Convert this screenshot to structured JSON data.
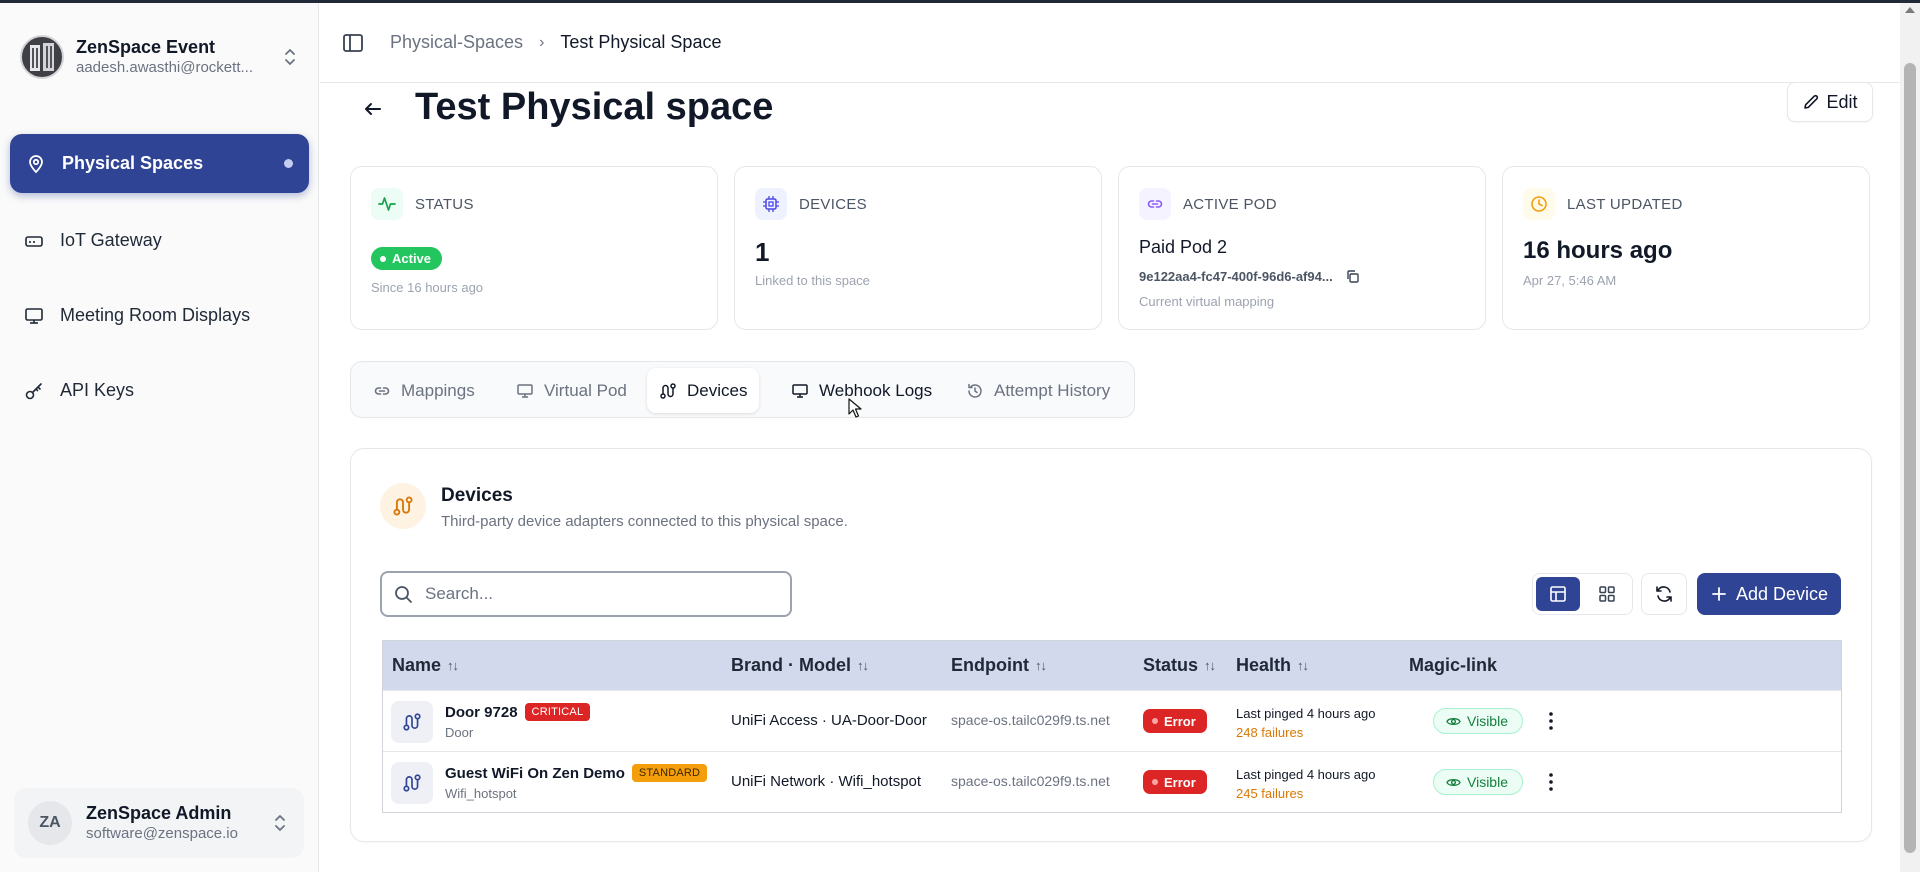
{
  "workspace": {
    "title": "ZenSpace Event",
    "subtitle": "aadesh.awasthi@rockett..."
  },
  "sidebar": {
    "items": [
      {
        "label": "Physical Spaces",
        "icon": "map-pin-icon",
        "active": true
      },
      {
        "label": "IoT Gateway",
        "icon": "router-icon",
        "active": false
      },
      {
        "label": "Meeting Room Displays",
        "icon": "monitor-icon",
        "active": false
      },
      {
        "label": "API Keys",
        "icon": "key-icon",
        "active": false
      }
    ]
  },
  "user": {
    "initials": "ZA",
    "name": "ZenSpace Admin",
    "email": "software@zenspace.io"
  },
  "breadcrumb": {
    "parent": "Physical-Spaces",
    "current": "Test Physical Space"
  },
  "page": {
    "title": "Test Physical space",
    "edit_label": "Edit"
  },
  "cards": {
    "status": {
      "label": "STATUS",
      "badge": "Active",
      "sub": "Since 16 hours ago"
    },
    "devices": {
      "label": "DEVICES",
      "value": "1",
      "sub": "Linked to this space"
    },
    "pod": {
      "label": "ACTIVE POD",
      "name": "Paid Pod 2",
      "id": "9e122aa4-fc47-400f-96d6-af94...",
      "sub": "Current virtual mapping"
    },
    "updated": {
      "label": "LAST UPDATED",
      "value": "16 hours ago",
      "sub": "Apr 27, 5:46 AM"
    }
  },
  "tabs": [
    {
      "label": "Mappings",
      "icon": "link-icon"
    },
    {
      "label": "Virtual Pod",
      "icon": "monitor-icon"
    },
    {
      "label": "Devices",
      "icon": "route-icon",
      "active": true
    },
    {
      "label": "Webhook Logs",
      "icon": "monitor-icon"
    },
    {
      "label": "Attempt History",
      "icon": "history-icon"
    }
  ],
  "devices_panel": {
    "title": "Devices",
    "subtitle": "Third-party device adapters connected to this physical space.",
    "search_placeholder": "Search...",
    "add_label": "Add Device",
    "columns": [
      "Name",
      "Brand · Model",
      "Endpoint",
      "Status",
      "Health",
      "Magic-link"
    ],
    "rows": [
      {
        "name": "Door 9728",
        "tag": "CRITICAL",
        "type": "Door",
        "brand_model": "UniFi Access · UA-Door-Door",
        "endpoint": "space-os.tailc029f9.ts.net",
        "status": "Error",
        "health": "Last pinged 4 hours ago",
        "failures": "248 failures",
        "magic_link": "Visible"
      },
      {
        "name": "Guest WiFi On Zen Demo",
        "tag": "STANDARD",
        "type": "Wifi_hotspot",
        "brand_model": "UniFi Network · Wifi_hotspot",
        "endpoint": "space-os.tailc029f9.ts.net",
        "status": "Error",
        "health": "Last pinged 4 hours ago",
        "failures": "245 failures",
        "magic_link": "Visible"
      }
    ]
  },
  "colors": {
    "accent": "#2f4494",
    "active_green": "#22c55e",
    "error_red": "#dc2626",
    "warning_amber": "#d97706"
  }
}
